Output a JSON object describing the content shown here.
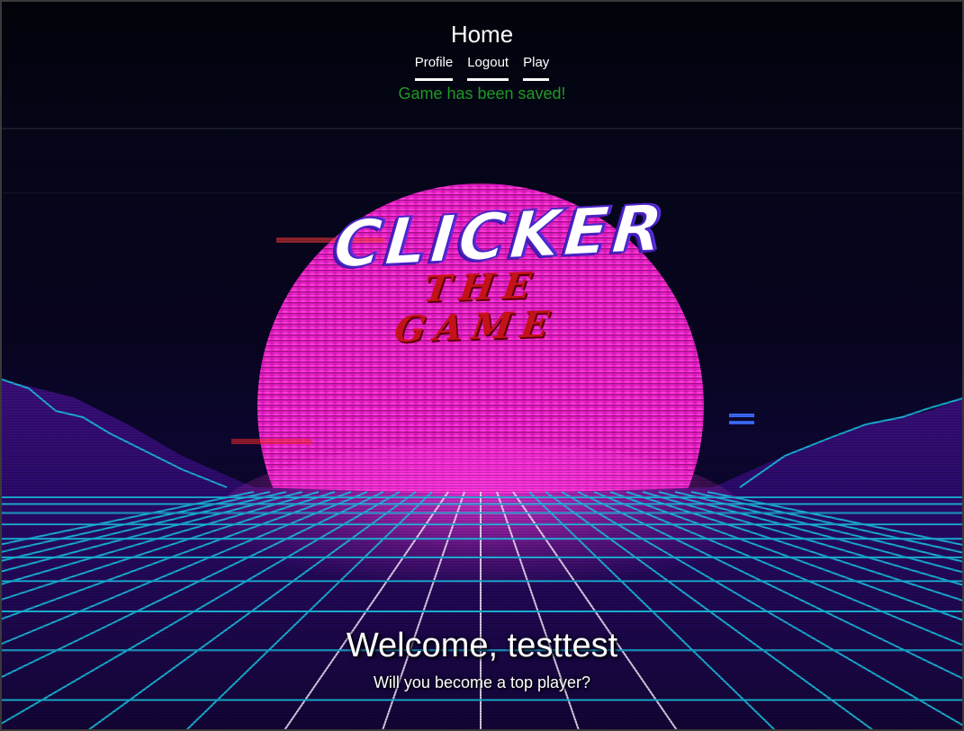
{
  "header": {
    "title": "Home",
    "nav": [
      {
        "label": "Profile"
      },
      {
        "label": "Logout"
      },
      {
        "label": "Play"
      }
    ],
    "status_message": "Game has been saved!"
  },
  "logo": {
    "word": "CLICKER",
    "subtitle": "THE GAME"
  },
  "welcome": {
    "title": "Welcome, testtest",
    "subtitle": "Will you become a top player?"
  },
  "colors": {
    "status": "#1e9a24",
    "sun": "#ff2bd6",
    "grid": "#19c8e8",
    "logo_sub": "#c4121a"
  }
}
